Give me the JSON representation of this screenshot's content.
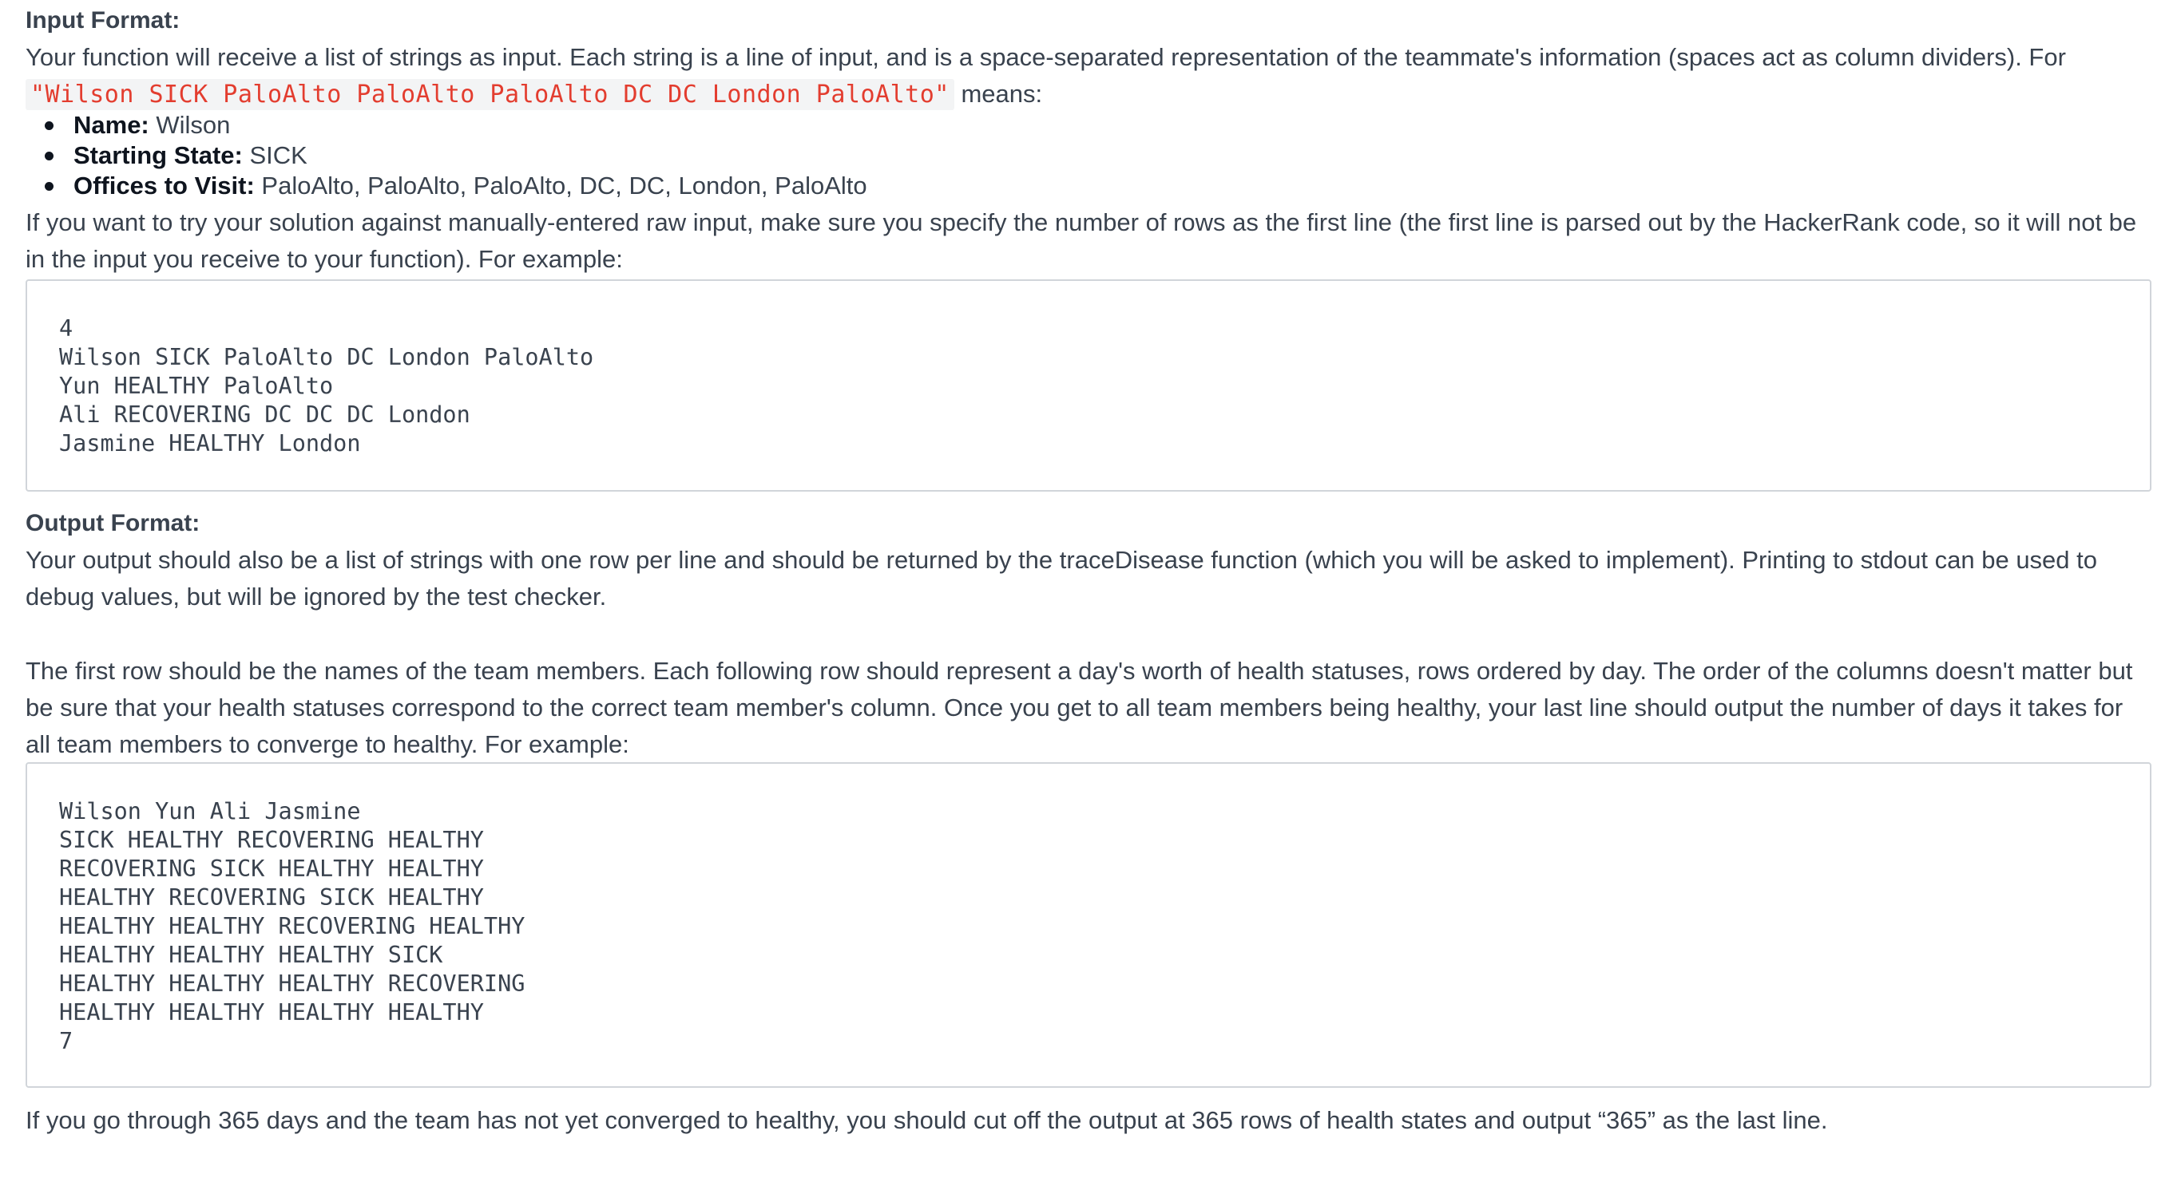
{
  "input_section": {
    "heading": "Input Format:",
    "intro": "Your function will receive a list of strings as input. Each string is a line of input, and is a space-separated representation of the teammate's information (spaces act as column dividers). For example:",
    "example_code": "\"Wilson SICK PaloAlto PaloAlto PaloAlto DC DC London PaloAlto\"",
    "example_suffix": " means:",
    "bullets": [
      {
        "label": "Name:",
        "value": " Wilson"
      },
      {
        "label": "Starting State:",
        "value": " SICK"
      },
      {
        "label": "Offices to Visit:",
        "value": " PaloAlto, PaloAlto, PaloAlto, DC, DC, London, PaloAlto"
      }
    ],
    "raw_input_note": "If you want to try your solution against manually-entered raw input, make sure you specify the number of rows as the first line (the first line is parsed out by the HackerRank code, so it will not be in the input you receive to your function). For example:",
    "sample_input": "4\nWilson SICK PaloAlto DC London PaloAlto\nYun HEALTHY PaloAlto\nAli RECOVERING DC DC DC London\nJasmine HEALTHY London"
  },
  "output_section": {
    "heading": "Output Format:",
    "para1": "Your output should also be a list of strings with one row per line and should be returned by the traceDisease function (which you will be asked to implement). Printing to stdout can be used to debug values, but will be ignored by the test checker.",
    "para2": "The first row should be the names of the team members. Each following row should represent a day's worth of health statuses, rows ordered by day. The order of the columns doesn't matter but be sure that your health statuses correspond to the correct team member's column. Once you get to all team members being healthy, your last line should output the number of days it takes for all team members to converge to healthy. For example:",
    "sample_output": "Wilson Yun Ali Jasmine\nSICK HEALTHY RECOVERING HEALTHY\nRECOVERING SICK HEALTHY HEALTHY\nHEALTHY RECOVERING SICK HEALTHY\nHEALTHY HEALTHY RECOVERING HEALTHY\nHEALTHY HEALTHY HEALTHY SICK\nHEALTHY HEALTHY HEALTHY RECOVERING\nHEALTHY HEALTHY HEALTHY HEALTHY\n7",
    "cutoff_note": "If you go through 365 days and the team has not yet converged to healthy, you should cut off the output at 365 rows of health states and output “365” as the last line."
  }
}
